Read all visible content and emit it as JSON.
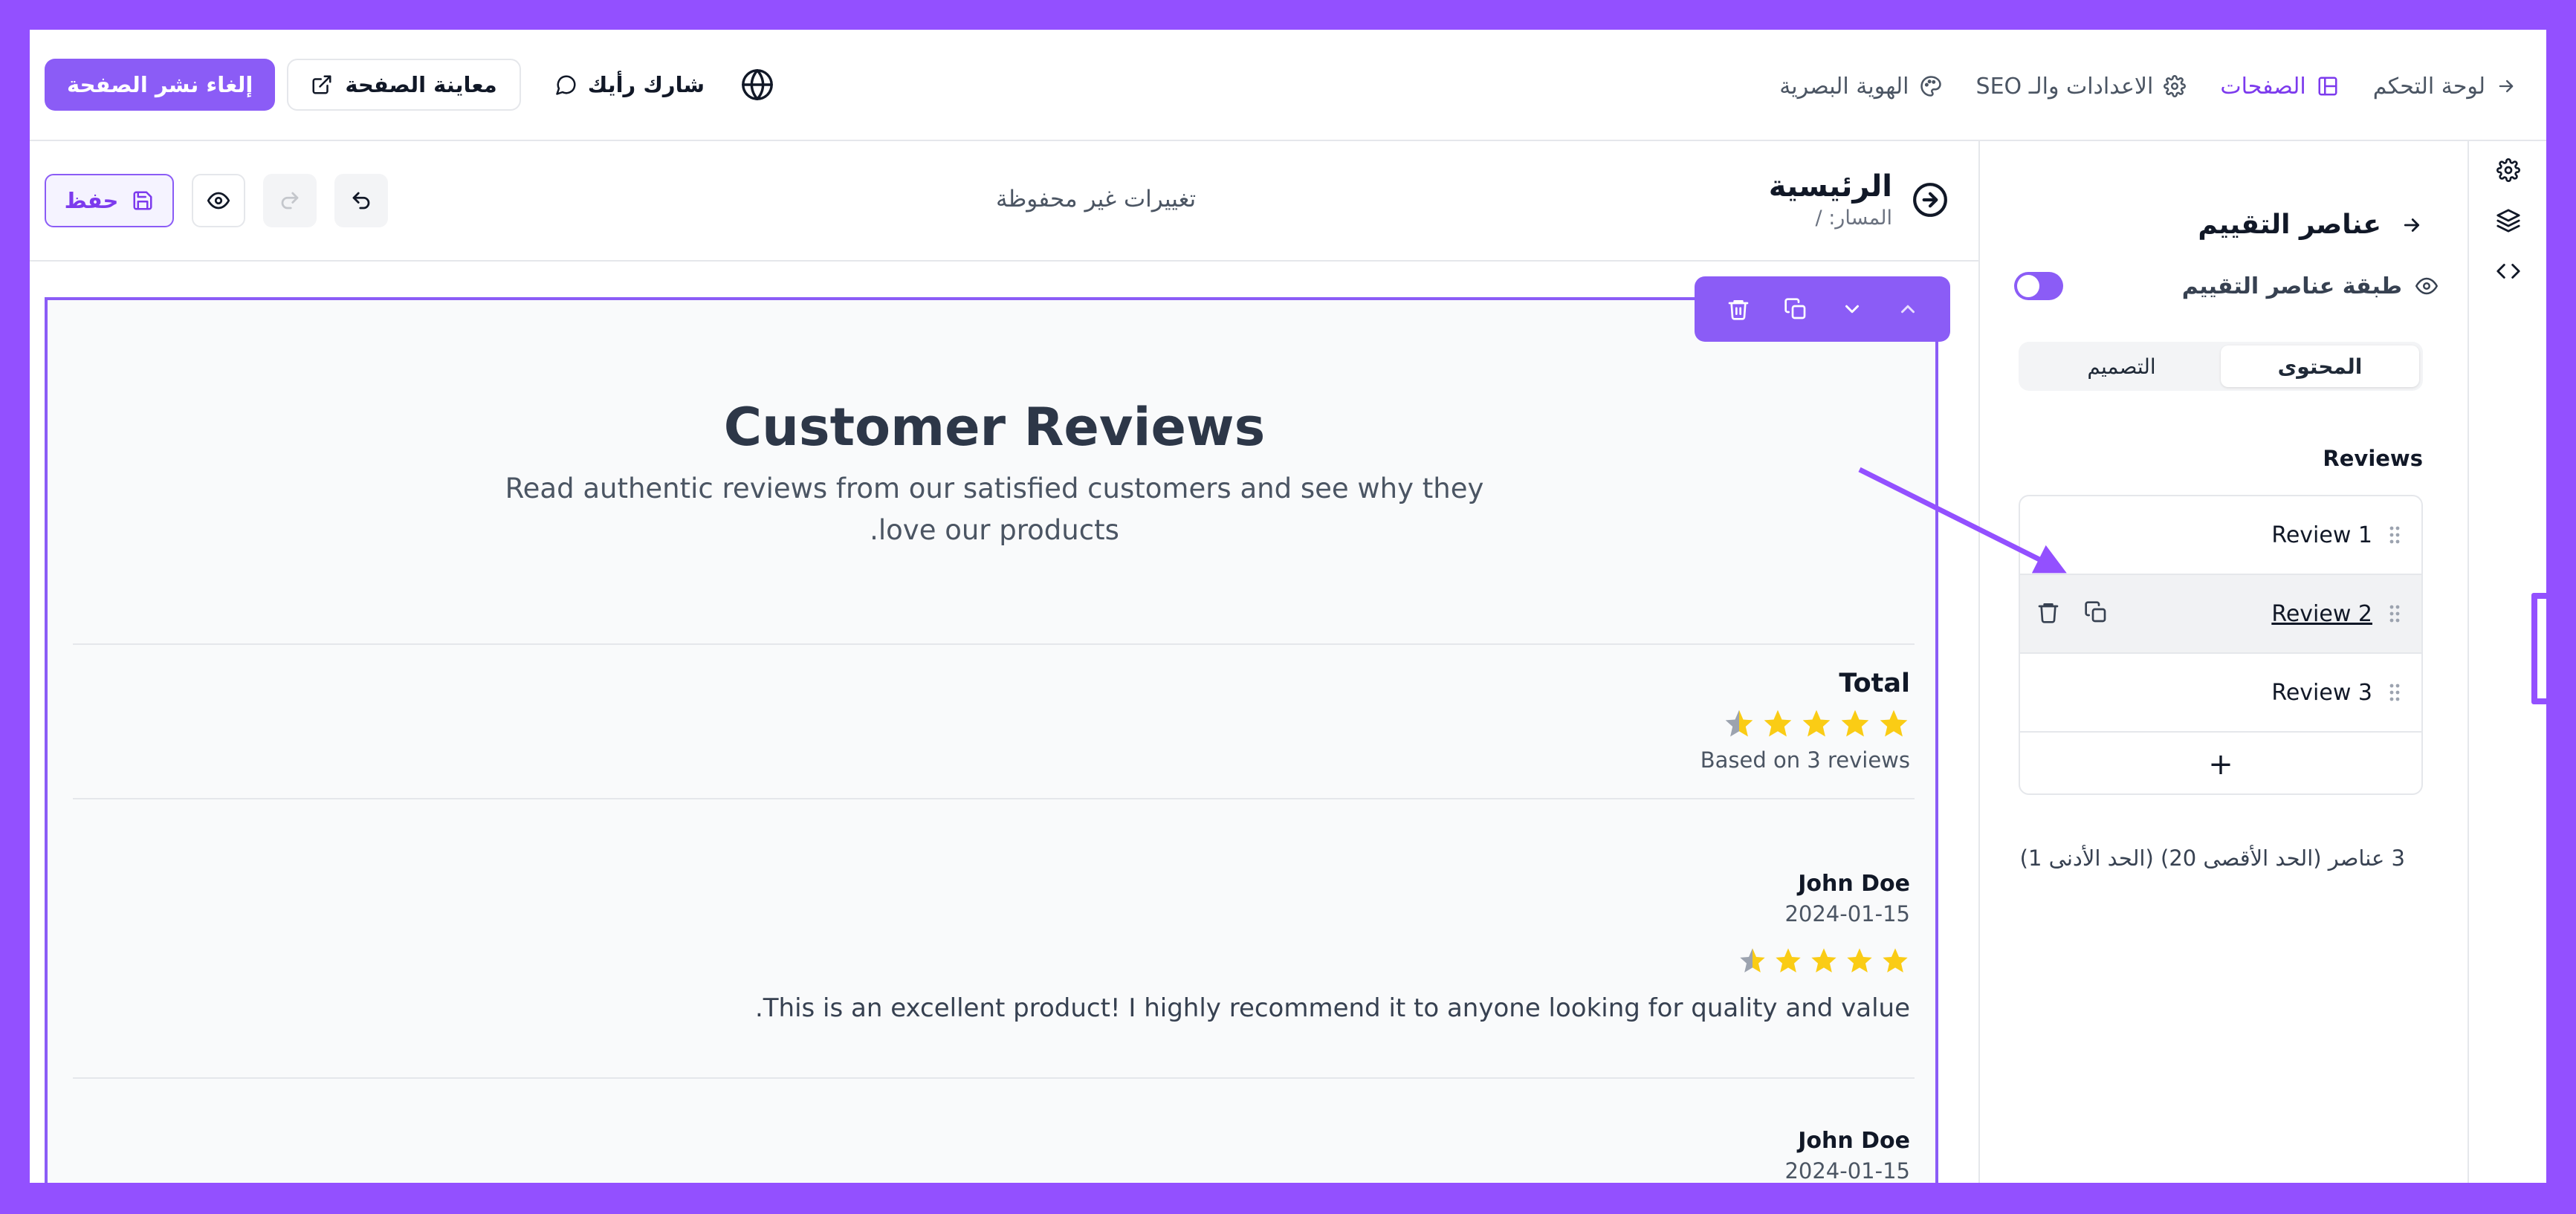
{
  "topbar": {
    "nav": [
      {
        "label": "لوحة التحكم",
        "icon": "arrow-right-icon",
        "active": false
      },
      {
        "label": "الصفحات",
        "icon": "layout-icon",
        "active": true
      },
      {
        "label": "الاعدادات والـ SEO",
        "icon": "gear-icon",
        "active": false
      },
      {
        "label": "الهوية البصرية",
        "icon": "palette-icon",
        "active": false
      }
    ],
    "unpublish_label": "إلغاء نشر الصفحة",
    "preview_label": "معاينة الصفحة",
    "feedback_label": "شارك رأيك"
  },
  "editor": {
    "page_title": "الرئيسية",
    "page_path": "المسار: /",
    "unsaved_label": "تغييرات غير محفوظة",
    "save_label": "حفظ"
  },
  "panel": {
    "title": "عناصر التقييم",
    "layer_label": "طبقة عناصر التقييم",
    "tabs": [
      {
        "label": "المحتوى",
        "active": true
      },
      {
        "label": "التصميم",
        "active": false
      }
    ],
    "section_label": "Reviews",
    "items": [
      {
        "label": "Review 1",
        "selected": false
      },
      {
        "label": "Review 2",
        "selected": true
      },
      {
        "label": "Review 3",
        "selected": false
      }
    ],
    "add_label": "+",
    "count_label": "3 عناصر (الحد الأقصى 20) (الحد الأدنى 1)"
  },
  "preview": {
    "title": "Customer Reviews",
    "description": "Read authentic reviews from our satisfied customers and see why they love our products.",
    "total": {
      "heading": "Total",
      "rating": 4.5,
      "subtitle": "Based on 3 reviews"
    },
    "reviews": [
      {
        "author": "John Doe",
        "date": "2024-01-15",
        "rating": 4.5,
        "text": "This is an excellent product! I highly recommend it to anyone looking for quality and value."
      },
      {
        "author": "John Doe",
        "date": "2024-01-15",
        "rating": null,
        "text": ""
      }
    ]
  },
  "colors": {
    "accent": "#8b5cf6",
    "accent_text": "#7c3aed",
    "frame": "#9350ff",
    "star": "#facc15",
    "star_empty": "#9ca3af"
  }
}
